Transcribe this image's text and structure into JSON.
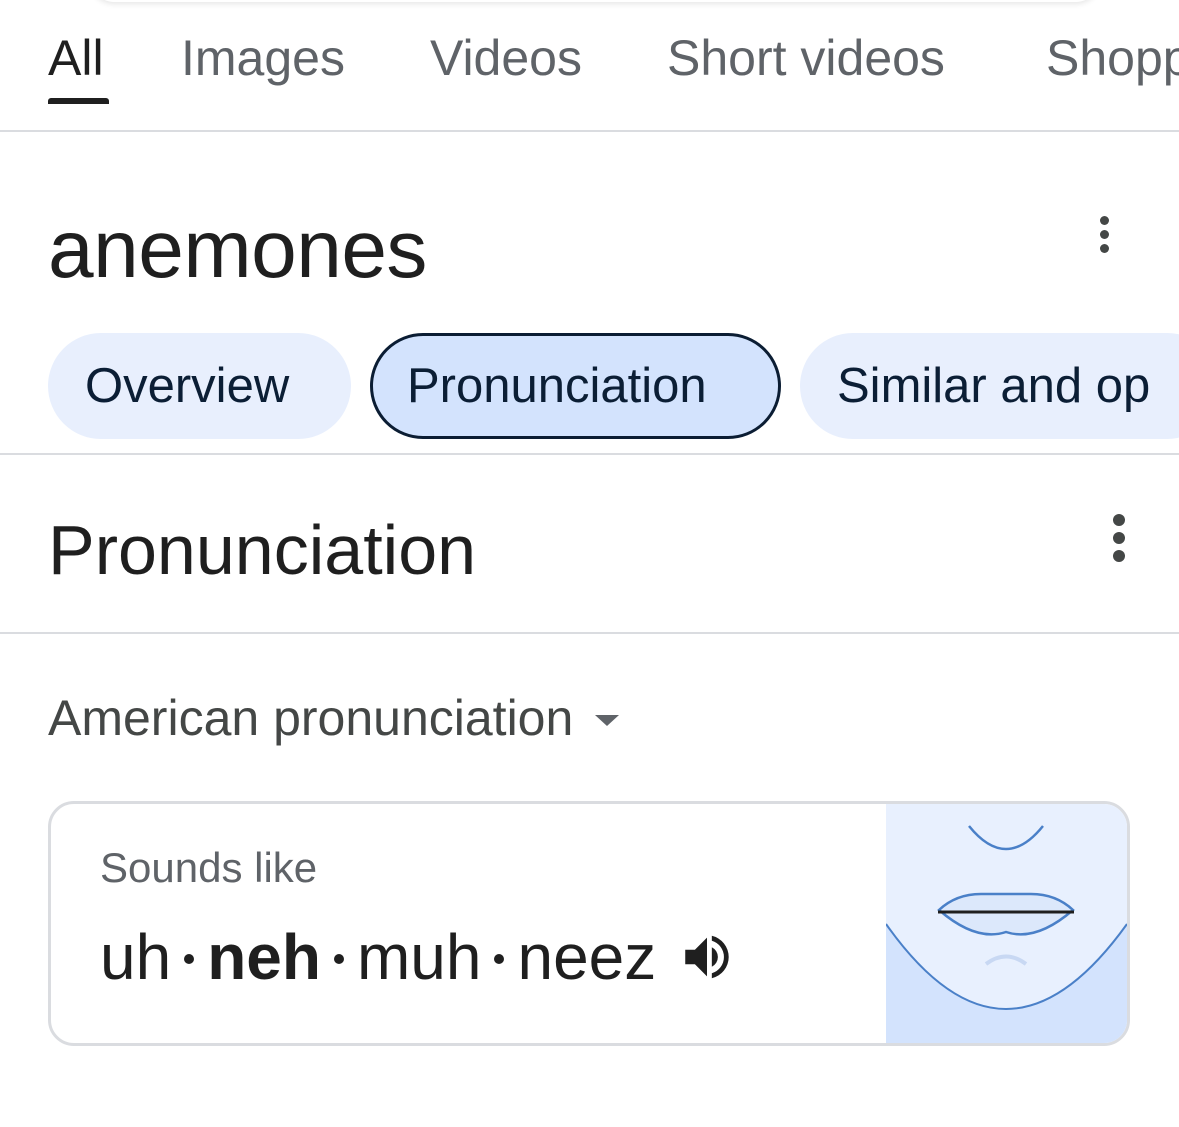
{
  "tabs": [
    {
      "label": "All",
      "active": true
    },
    {
      "label": "Images"
    },
    {
      "label": "Videos"
    },
    {
      "label": "Short videos"
    },
    {
      "label": "Shopp"
    }
  ],
  "header": {
    "word": "anemones"
  },
  "chips": [
    {
      "label": "Overview"
    },
    {
      "label": "Pronunciation",
      "selected": true
    },
    {
      "label": "Similar and op"
    }
  ],
  "section": {
    "title": "Pronunciation"
  },
  "accent_dropdown": {
    "selected": "American pronunciation"
  },
  "card": {
    "sounds_like_label": "Sounds like",
    "syllables": [
      {
        "text": "uh",
        "stressed": false
      },
      {
        "text": "neh",
        "stressed": true
      },
      {
        "text": "muh",
        "stressed": false
      },
      {
        "text": "neez",
        "stressed": false
      }
    ],
    "speaker_icon": "volume-up-icon",
    "illustration_icon": "mouth-illustration"
  },
  "colors": {
    "chip_bg": "#e8effd",
    "chip_selected_bg": "#d3e3fd",
    "illustration_bg": "#e8f0fe",
    "illustration_lower": "#d3e3fd",
    "illustration_stroke": "#4a80c8"
  }
}
